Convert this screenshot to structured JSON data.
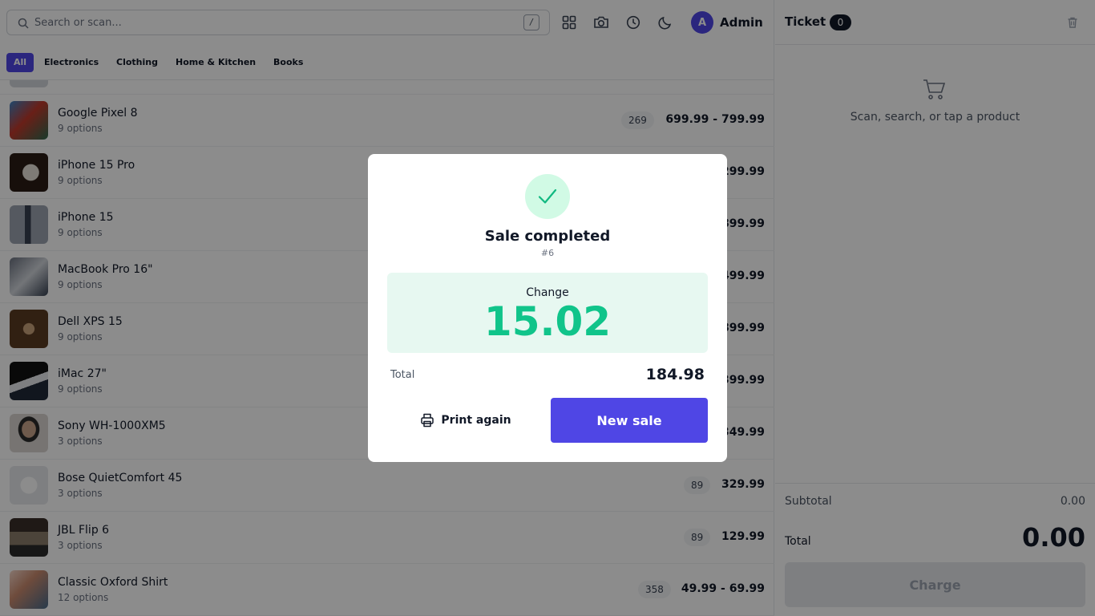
{
  "search": {
    "placeholder": "Search or scan...",
    "shortcut": "/"
  },
  "user": {
    "initial": "A",
    "name": "Admin"
  },
  "categories": [
    {
      "label": "All",
      "active": true
    },
    {
      "label": "Electronics"
    },
    {
      "label": "Clothing"
    },
    {
      "label": "Home & Kitchen"
    },
    {
      "label": "Books"
    }
  ],
  "products": [
    {
      "name": "Google Pixel 8",
      "options": "9 options",
      "stock": "269",
      "price": "699.99 - 799.99",
      "thumb_color": "#7a5b48"
    },
    {
      "name": "iPhone 15 Pro",
      "options": "9 options",
      "stock": "",
      "price": "1,099.99 - 1,299.99",
      "thumb_color": "#3a2a1e"
    },
    {
      "name": "iPhone 15",
      "options": "9 options",
      "stock": "",
      "price": "799.99 - 899.99",
      "thumb_color": "#6b7280"
    },
    {
      "name": "MacBook Pro 16\"",
      "options": "9 options",
      "stock": "",
      "price": "2,499.99 - 3,499.99",
      "thumb_color": "#4b4b4b"
    },
    {
      "name": "Dell XPS 15",
      "options": "9 options",
      "stock": "",
      "price": "1,299.99 - 1,899.99",
      "thumb_color": "#5a3b22"
    },
    {
      "name": "iMac 27\"",
      "options": "9 options",
      "stock": "",
      "price": "1,799.99 - 2,399.99",
      "thumb_color": "#2b2b2b"
    },
    {
      "name": "Sony WH-1000XM5",
      "options": "3 options",
      "stock": "",
      "price": "349.99",
      "thumb_color": "#b9a89a"
    },
    {
      "name": "Bose QuietComfort 45",
      "options": "3 options",
      "stock": "89",
      "price": "329.99",
      "thumb_color": "#e5e7eb"
    },
    {
      "name": "JBL Flip 6",
      "options": "3 options",
      "stock": "89",
      "price": "129.99",
      "thumb_color": "#5c4a3a"
    },
    {
      "name": "Classic Oxford Shirt",
      "options": "12 options",
      "stock": "358",
      "price": "49.99 - 69.99",
      "thumb_color": "#c98a6e"
    }
  ],
  "ticket": {
    "title": "Ticket",
    "count": "0",
    "empty_text": "Scan, search, or tap a product",
    "subtotal_label": "Subtotal",
    "subtotal_value": "0.00",
    "total_label": "Total",
    "total_value": "0.00",
    "charge_label": "Charge"
  },
  "modal": {
    "title": "Sale completed",
    "number": "#6",
    "change_label": "Change",
    "change_value": "15.02",
    "total_label": "Total",
    "total_value": "184.98",
    "print_label": "Print again",
    "new_sale_label": "New sale"
  },
  "colors": {
    "accent": "#4f46e5",
    "success": "#10c48a",
    "success_bg": "#e7f8f1"
  }
}
